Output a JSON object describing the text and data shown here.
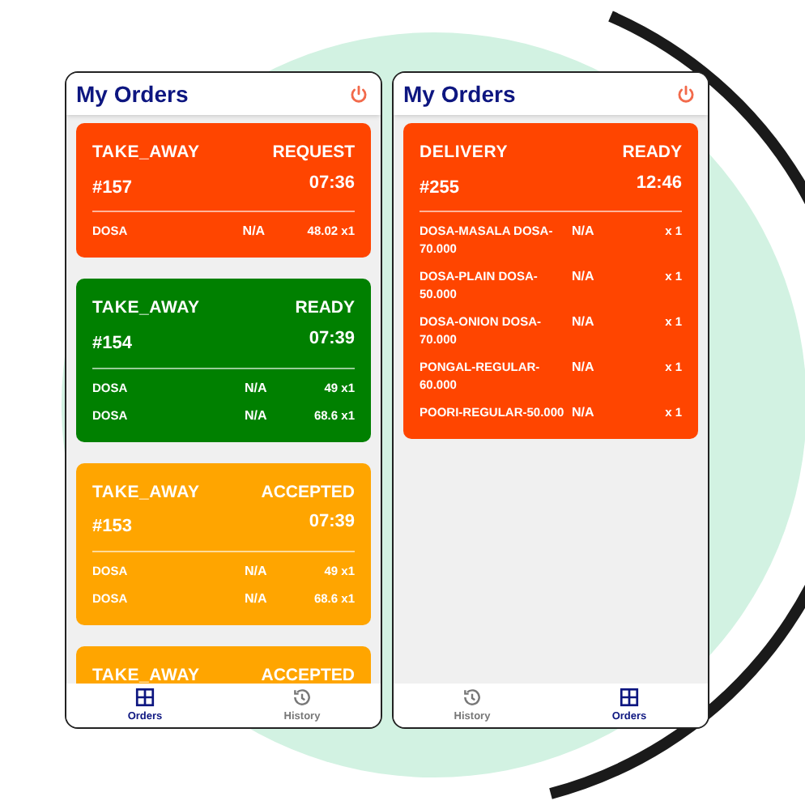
{
  "apps": [
    {
      "title": "My Orders",
      "orders": [
        {
          "type": "TAKE_AWAY",
          "status": "REQUEST",
          "number": "#157",
          "time": "07:36",
          "color": "#ff4500",
          "items": [
            {
              "name": "DOSA",
              "note": "N/A",
              "qty": "48.02 x1"
            }
          ]
        },
        {
          "type": "TAKE_AWAY",
          "status": "READY",
          "number": "#154",
          "time": "07:39",
          "color": "#008000",
          "items": [
            {
              "name": "DOSA",
              "note": "N/A",
              "qty": "49 x1"
            },
            {
              "name": "DOSA",
              "note": "N/A",
              "qty": "68.6 x1"
            }
          ]
        },
        {
          "type": "TAKE_AWAY",
          "status": "ACCEPTED",
          "number": "#153",
          "time": "07:39",
          "color": "#ffa500",
          "items": [
            {
              "name": "DOSA",
              "note": "N/A",
              "qty": "49 x1"
            },
            {
              "name": "DOSA",
              "note": "N/A",
              "qty": "68.6 x1"
            }
          ]
        },
        {
          "type": "TAKE_AWAY",
          "status": "ACCEPTED",
          "color": "#ffa500"
        }
      ],
      "nav": [
        {
          "label": "Orders",
          "kind": "orders",
          "selected": true
        },
        {
          "label": "History",
          "kind": "history",
          "selected": false
        }
      ]
    },
    {
      "title": "My Orders",
      "orders": [
        {
          "type": "DELIVERY",
          "status": "READY",
          "number": "#255",
          "time": "12:46",
          "color": "#ff4500",
          "items": [
            {
              "name": "DOSA-MASALA DOSA-70.000",
              "note": "N/A",
              "qty": "x 1"
            },
            {
              "name": "DOSA-PLAIN DOSA-50.000",
              "note": "N/A",
              "qty": "x 1"
            },
            {
              "name": "DOSA-ONION DOSA-70.000",
              "note": "N/A",
              "qty": "x 1"
            },
            {
              "name": "PONGAL-REGULAR-60.000",
              "note": "N/A",
              "qty": "x 1"
            },
            {
              "name": "POORI-REGULAR-50.000",
              "note": "N/A",
              "qty": "x 1"
            }
          ]
        }
      ],
      "nav": [
        {
          "label": "History",
          "kind": "history",
          "selected": false
        },
        {
          "label": "Orders",
          "kind": "orders",
          "selected": true
        }
      ]
    }
  ]
}
